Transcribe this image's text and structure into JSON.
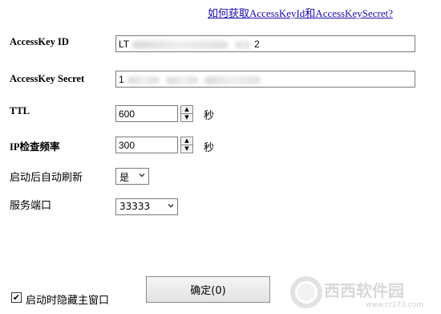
{
  "help_link": "如何获取AccessKeyId和AccessKeySecret?",
  "fields": {
    "access_key_id": {
      "label": "AccessKey ID",
      "value_start": "LT",
      "value_end": "2"
    },
    "access_key_secret": {
      "label": "AccessKey Secret",
      "value_start": "1"
    },
    "ttl": {
      "label": "TTL",
      "value": "600",
      "unit": "秒"
    },
    "ip_interval": {
      "label": "IP检查频率",
      "value": "300",
      "unit": "秒"
    },
    "auto_refresh": {
      "label": "启动后自动刷新",
      "value": "是"
    },
    "port": {
      "label": "服务端口",
      "value": "33333"
    }
  },
  "bottom": {
    "hide_checkbox_label": "启动时隐藏主窗口",
    "hide_checked": true,
    "ok_button": "确定(0)"
  },
  "watermark": {
    "text": "西西软件园",
    "url": "www.cr173.com"
  },
  "icons": {
    "spin_up": "triangle-up",
    "spin_down": "triangle-down",
    "dropdown": "chevron-down"
  }
}
